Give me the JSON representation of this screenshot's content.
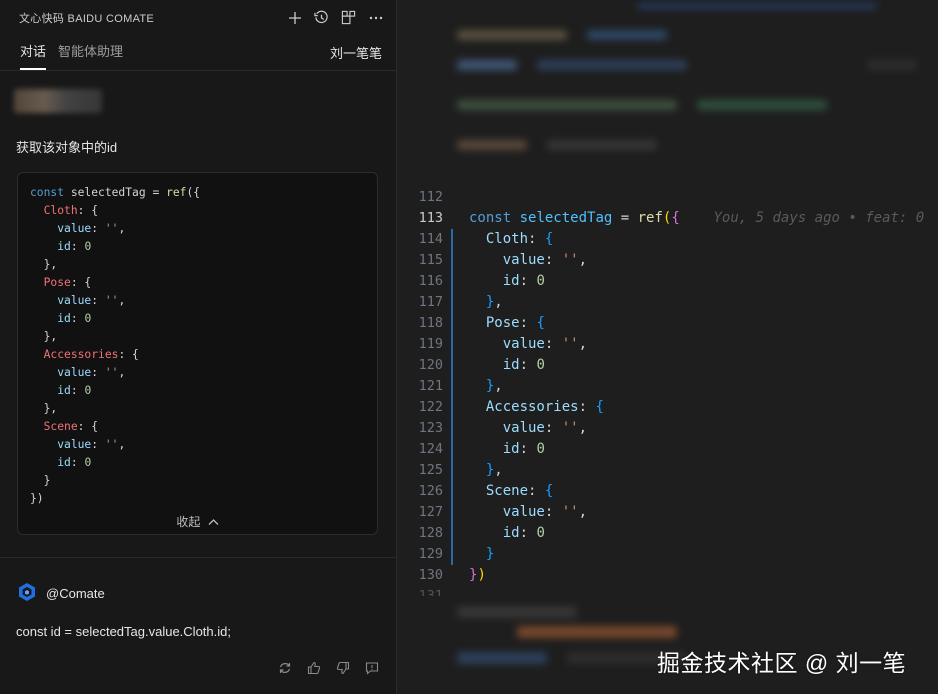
{
  "panel": {
    "title": "文心快码 BAIDU COMATE",
    "icons": [
      "plus-icon",
      "history-icon",
      "layout-icon",
      "more-icon"
    ],
    "tabs": [
      {
        "label": "对话",
        "active": true
      },
      {
        "label": "智能体助理",
        "active": false
      }
    ],
    "user": "刘一笔笔"
  },
  "chat": {
    "question": "获取该对象中的id",
    "collapse_label": "收起",
    "answer_author": "@Comate",
    "answer_text": "const id = selectedTag.value.Cloth.id;"
  },
  "editor": {
    "line_numbers": [
      "112",
      "113",
      "114",
      "115",
      "116",
      "117",
      "118",
      "119",
      "120",
      "121",
      "122",
      "123",
      "124",
      "125",
      "126",
      "127",
      "128",
      "129",
      "130",
      "131"
    ],
    "current_line": "113",
    "blame": "You, 5 days ago • feat: 0"
  },
  "watermark": "掘金技术社区 @ 刘一笔",
  "colors": {
    "accent": "#2a6aa8",
    "background": "#1e1e1e",
    "panel": "#181818"
  }
}
